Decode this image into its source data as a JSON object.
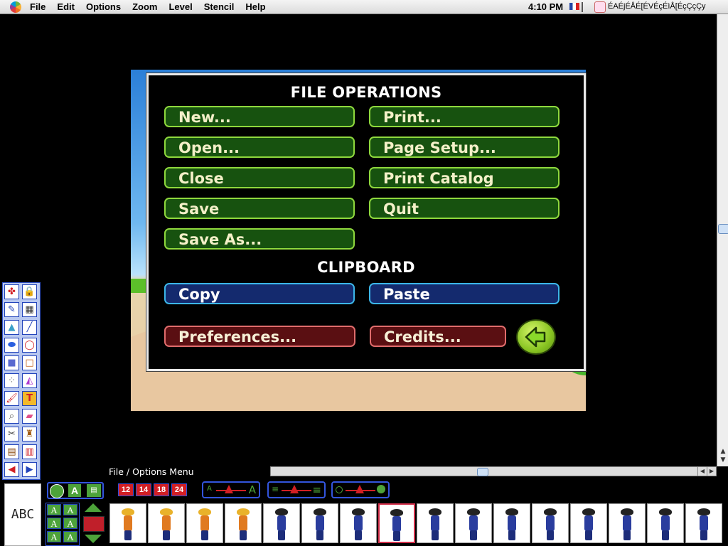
{
  "menubar": {
    "menus": [
      "File",
      "Edit",
      "Options",
      "Zoom",
      "Level",
      "Stencil",
      "Help"
    ],
    "clock": "4:10 PM",
    "app_title": "ÉAÉjÉÅÉ[ÉVÉçÉìÅ[ÉçÇçÇy"
  },
  "dialog": {
    "file_heading": "FILE OPERATIONS",
    "clipboard_heading": "CLIPBOARD",
    "buttons": {
      "new": "New...",
      "print": "Print...",
      "open": "Open...",
      "page_setup": "Page Setup...",
      "close": "Close",
      "print_catalog": "Print Catalog",
      "save": "Save",
      "quit": "Quit",
      "save_as": "Save As...",
      "copy": "Copy",
      "paste": "Paste",
      "preferences": "Preferences...",
      "credits": "Credits..."
    },
    "back_icon": "back-arrow-icon"
  },
  "status": {
    "text": "File / Options Menu"
  },
  "text_preview": "ABC",
  "font_sizes": [
    "12",
    "14",
    "18",
    "24"
  ],
  "font_styles": [
    "A",
    "A",
    "A",
    "A",
    "A",
    "A"
  ],
  "colors": {
    "green_button_border": "#8fd83d",
    "green_button_fill": "#17520f",
    "blue_button_border": "#3cb6e8",
    "blue_button_fill": "#142a6e",
    "red_button_border": "#e06c6c",
    "red_button_fill": "#5a0f12",
    "palette_accent": "#d21f24"
  },
  "tools": [
    "pattern-icon",
    "lock-icon",
    "eyedropper-icon",
    "clapper-icon",
    "triangle-icon",
    "line-icon",
    "filled-oval-icon",
    "oval-icon",
    "filled-rect-icon",
    "rect-icon",
    "spray-icon",
    "paint-bucket-icon",
    "brush-icon",
    "text-tool-icon",
    "magnifier-icon",
    "eraser-icon",
    "scissors-icon",
    "stamp-icon",
    "box-icon",
    "film-icon",
    "prev-arrow-icon",
    "next-arrow-icon"
  ],
  "sprites": [
    {
      "hair": "#e9b22a",
      "body": "#e07a20"
    },
    {
      "hair": "#e9b22a",
      "body": "#e07a20"
    },
    {
      "hair": "#e9b22a",
      "body": "#e07a20"
    },
    {
      "hair": "#e9b22a",
      "body": "#e07a20"
    },
    {
      "hair": "#222222",
      "body": "#2a3d9e"
    },
    {
      "hair": "#222222",
      "body": "#2a3d9e"
    },
    {
      "hair": "#222222",
      "body": "#2a3d9e"
    },
    {
      "hair": "#222222",
      "body": "#2a3d9e"
    },
    {
      "hair": "#222222",
      "body": "#2a3d9e"
    },
    {
      "hair": "#222222",
      "body": "#2a3d9e"
    },
    {
      "hair": "#222222",
      "body": "#2a3d9e"
    },
    {
      "hair": "#222222",
      "body": "#2a3d9e"
    },
    {
      "hair": "#222222",
      "body": "#2a3d9e"
    },
    {
      "hair": "#222222",
      "body": "#2a3d9e"
    },
    {
      "hair": "#222222",
      "body": "#2a3d9e"
    },
    {
      "hair": "#222222",
      "body": "#2a3d9e"
    }
  ],
  "selected_sprite": 7
}
